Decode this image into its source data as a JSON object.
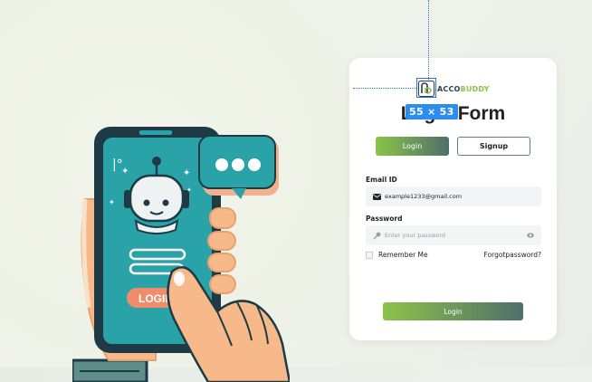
{
  "overlay": {
    "size_label": "55 × 53"
  },
  "brand": {
    "logo_part1": "ACCO",
    "logo_part2": "BUDDY"
  },
  "form": {
    "title": "Login Form",
    "tabs": {
      "login": "Login",
      "signup": "Signup"
    },
    "email": {
      "label": "Email ID",
      "value": "example1233@gmail.com"
    },
    "password": {
      "label": "Password",
      "placeholder": "Enter your password"
    },
    "remember_label": "Remember Me",
    "forgot_label": "Forgotpassword?",
    "submit_label": "Login"
  },
  "illustration": {
    "phone_button_label": "LOGIN"
  },
  "colors": {
    "accent_start": "#8bc34a",
    "accent_end": "#4f6f6a",
    "overlay_blue": "#2d74d6"
  }
}
